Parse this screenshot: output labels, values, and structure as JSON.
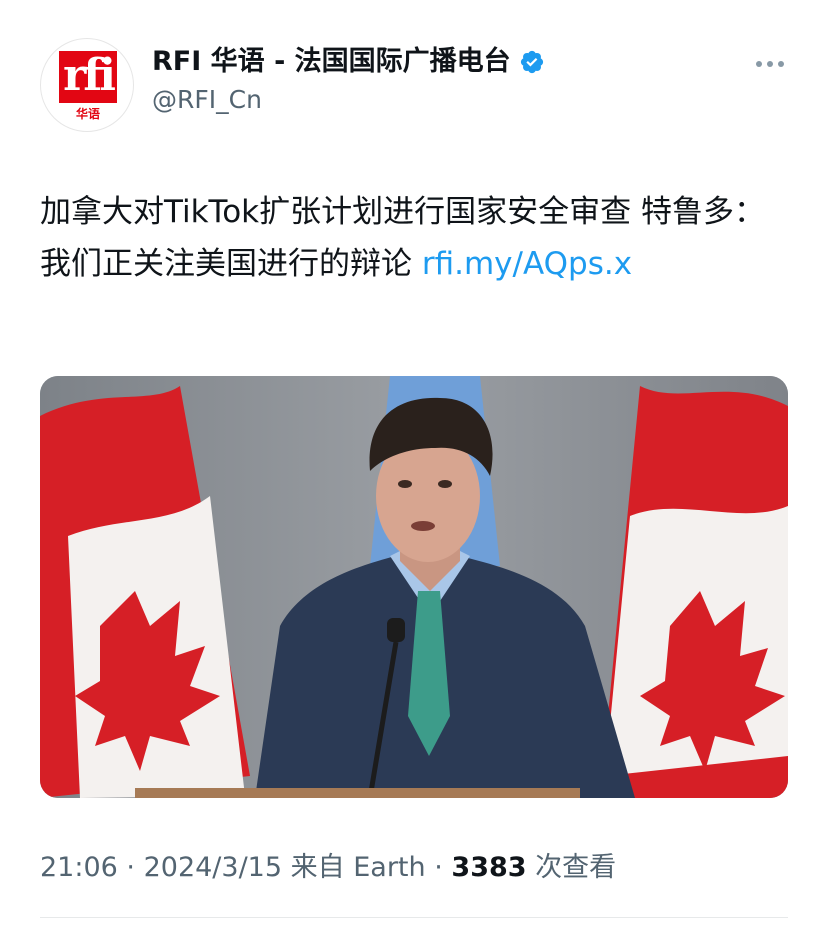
{
  "account": {
    "display_name": "RFI 华语 - 法国国际广播电台",
    "handle": "@RFI_Cn",
    "verified": true,
    "logo_text": "rfi",
    "logo_subtext": "华语"
  },
  "tweet": {
    "text": "加拿大对TikTok扩张计划进行国家安全审查 特鲁多：我们正关注美国进行的辩论 ",
    "link": "rfi.my/AQps.x"
  },
  "meta": {
    "time": "21:06",
    "date": "2024/3/15",
    "source": "来自 Earth",
    "views_count": "3383",
    "views_label": "次查看",
    "separator": "·"
  },
  "colors": {
    "link": "#1d9bf0",
    "verified": "#1d9bf0",
    "rfi_red": "#e20613",
    "secondary_text": "#536471"
  }
}
